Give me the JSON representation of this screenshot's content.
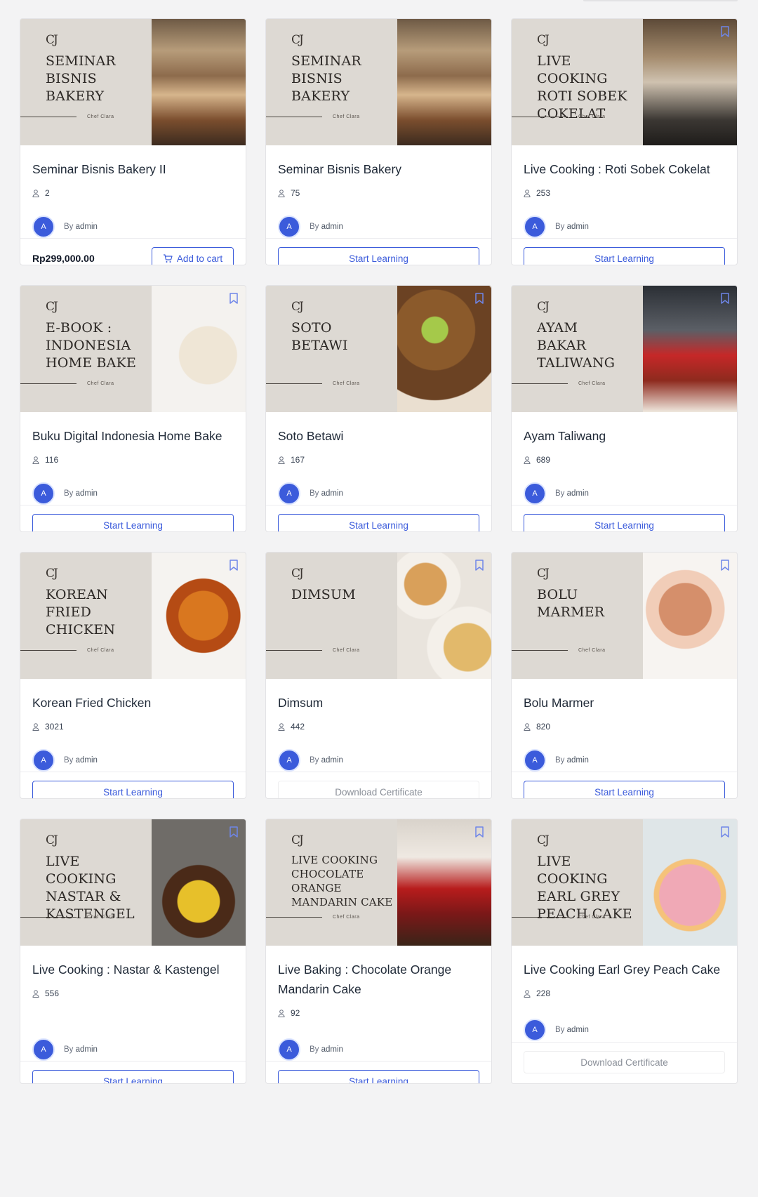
{
  "brand_mark": "CJ",
  "thumb_chef": "Chef Clara",
  "courses": [
    {
      "thumb_title": "SEMINAR\nBISNIS\nBAKERY",
      "photo": "seminar",
      "title": "Seminar Bisnis Bakery II",
      "students": "2",
      "author_initial": "A",
      "by_label": "By",
      "author": "admin",
      "price": "Rp299,000.00",
      "action": "Add to cart",
      "action_type": "cart",
      "bookmark": false
    },
    {
      "thumb_title": "SEMINAR\nBISNIS\nBAKERY",
      "photo": "seminar",
      "title": "Seminar Bisnis Bakery",
      "students": "75",
      "author_initial": "A",
      "by_label": "By",
      "author": "admin",
      "price": "",
      "action": "Start Learning",
      "action_type": "primary",
      "bookmark": false
    },
    {
      "thumb_title": "LIVE COOKING\nROTI SOBEK\nCOKELAT",
      "photo": "kitchen",
      "title": "Live Cooking : Roti Sobek Cokelat",
      "students": "253",
      "author_initial": "A",
      "by_label": "By",
      "author": "admin",
      "price": "",
      "action": "Start Learning",
      "action_type": "primary",
      "bookmark": true
    },
    {
      "thumb_title": "E-BOOK :\nINDONESIA\nHOME BAKE",
      "photo": "book",
      "title": "Buku Digital Indonesia Home Bake",
      "students": "116",
      "author_initial": "A",
      "by_label": "By",
      "author": "admin",
      "price": "",
      "action": "Start Learning",
      "action_type": "primary",
      "bookmark": true
    },
    {
      "thumb_title": "SOTO\nBETAWI",
      "photo": "soto",
      "title": "Soto Betawi",
      "students": "167",
      "author_initial": "A",
      "by_label": "By",
      "author": "admin",
      "price": "",
      "action": "Start Learning",
      "action_type": "primary",
      "bookmark": true
    },
    {
      "thumb_title": "AYAM\nBAKAR\nTALIWANG",
      "photo": "ayam",
      "title": "Ayam Taliwang",
      "students": "689",
      "author_initial": "A",
      "by_label": "By",
      "author": "admin",
      "price": "",
      "action": "Start Learning",
      "action_type": "primary",
      "bookmark": true
    },
    {
      "thumb_title": "KOREAN\nFRIED\nCHICKEN",
      "photo": "kfc",
      "title": "Korean Fried Chicken",
      "students": "3021",
      "author_initial": "A",
      "by_label": "By",
      "author": "admin",
      "price": "",
      "action": "Start Learning",
      "action_type": "primary",
      "bookmark": true
    },
    {
      "thumb_title": "DIMSUM",
      "photo": "dimsum",
      "title": "Dimsum",
      "students": "442",
      "author_initial": "A",
      "by_label": "By",
      "author": "admin",
      "price": "",
      "action": "Download Certificate",
      "action_type": "disabled",
      "bookmark": true
    },
    {
      "thumb_title": "BOLU\nMARMER",
      "photo": "bolu",
      "title": "Bolu Marmer",
      "students": "820",
      "author_initial": "A",
      "by_label": "By",
      "author": "admin",
      "price": "",
      "action": "Start Learning",
      "action_type": "primary",
      "bookmark": true
    },
    {
      "thumb_title": "LIVE COOKING\nNASTAR &\nKASTENGEL",
      "photo": "nastar",
      "title": "Live Cooking : Nastar & Kastengel",
      "students": "556",
      "author_initial": "A",
      "by_label": "By",
      "author": "admin",
      "price": "",
      "action": "Start Learning",
      "action_type": "primary",
      "bookmark": true
    },
    {
      "thumb_title": "LIVE COOKING\nCHOCOLATE\nORANGE\nMANDARIN CAKE",
      "photo": "choc",
      "title": "Live Baking : Chocolate Orange Mandarin Cake",
      "students": "92",
      "author_initial": "A",
      "by_label": "By",
      "author": "admin",
      "price": "",
      "action": "Start Learning",
      "action_type": "primary",
      "bookmark": true
    },
    {
      "thumb_title": "LIVE COOKING\nEARL GREY\nPEACH CAKE",
      "photo": "peach",
      "title": "Live Cooking Earl Grey Peach Cake",
      "students": "228",
      "author_initial": "A",
      "by_label": "By",
      "author": "admin",
      "price": "",
      "action": "Download Certificate",
      "action_type": "disabled",
      "bookmark": true
    }
  ],
  "colors": {
    "accent": "#3b5bdb",
    "page_bg": "#f3f3f4",
    "thumb_bg": "#ddd9d3"
  }
}
